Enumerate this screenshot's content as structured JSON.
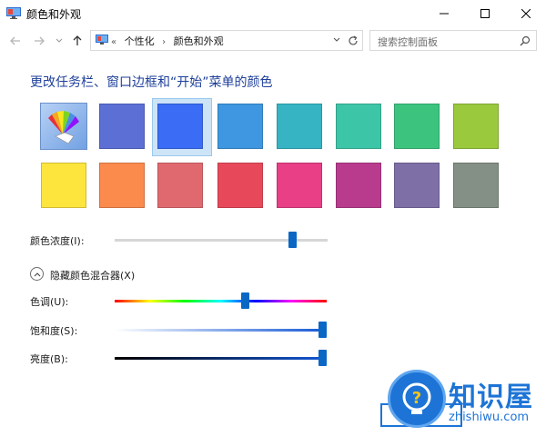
{
  "window": {
    "title": "颜色和外观"
  },
  "nav": {
    "breadcrumbs": [
      "个性化",
      "颜色和外观"
    ],
    "search_placeholder": "搜索控制面板"
  },
  "content": {
    "heading": "更改任务栏、窗口边框和“开始”菜单的颜色",
    "swatches_row1": [
      "auto",
      "#5b6fd5",
      "#3a6cf5",
      "#3e97e0",
      "#36b4c4",
      "#3dc5a7",
      "#3cc47f",
      "#9ac93e"
    ],
    "swatches_row2": [
      "#fde53e",
      "#fb8a4d",
      "#e06970",
      "#e8495a",
      "#e83f86",
      "#b93b8e",
      "#7e6fa6",
      "#848f85"
    ],
    "selected_index": 2,
    "intensity_label": "颜色浓度(I):",
    "intensity_value": 0.85,
    "mixer_toggle_label": "隐藏颜色混合器(X)",
    "hue_label": "色调(U):",
    "hue_value": 0.62,
    "saturation_label": "饱和度(S):",
    "saturation_value": 1.0,
    "brightness_label": "亮度(B):",
    "brightness_value": 1.0
  },
  "watermark": {
    "brand": "知识屋",
    "url": "zhishiwu.com"
  },
  "colors": {
    "accent": "#0b67c4",
    "heading": "#1e3f9a",
    "selected_bg": "#cde4f7"
  }
}
